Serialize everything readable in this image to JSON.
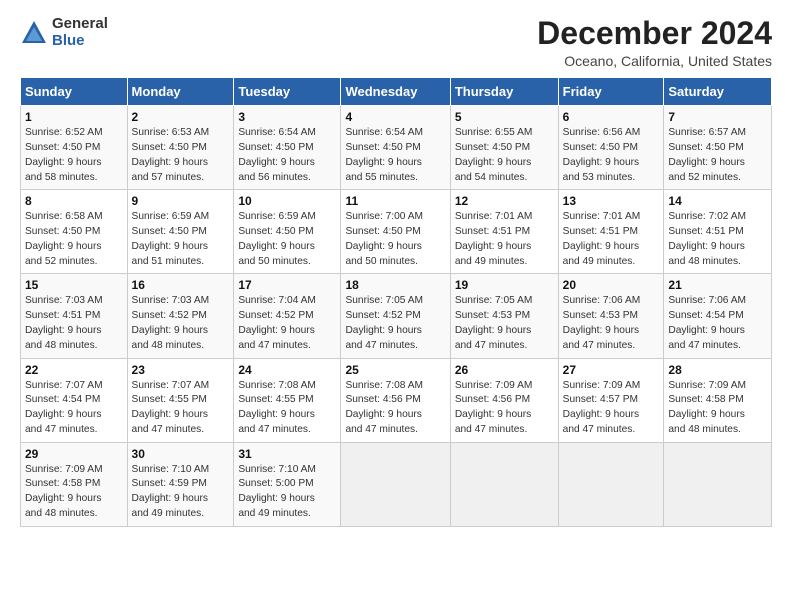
{
  "logo": {
    "text1": "General",
    "text2": "Blue"
  },
  "title": "December 2024",
  "subtitle": "Oceano, California, United States",
  "days_of_week": [
    "Sunday",
    "Monday",
    "Tuesday",
    "Wednesday",
    "Thursday",
    "Friday",
    "Saturday"
  ],
  "weeks": [
    [
      {
        "day": 1,
        "detail": "Sunrise: 6:52 AM\nSunset: 4:50 PM\nDaylight: 9 hours\nand 58 minutes."
      },
      {
        "day": 2,
        "detail": "Sunrise: 6:53 AM\nSunset: 4:50 PM\nDaylight: 9 hours\nand 57 minutes."
      },
      {
        "day": 3,
        "detail": "Sunrise: 6:54 AM\nSunset: 4:50 PM\nDaylight: 9 hours\nand 56 minutes."
      },
      {
        "day": 4,
        "detail": "Sunrise: 6:54 AM\nSunset: 4:50 PM\nDaylight: 9 hours\nand 55 minutes."
      },
      {
        "day": 5,
        "detail": "Sunrise: 6:55 AM\nSunset: 4:50 PM\nDaylight: 9 hours\nand 54 minutes."
      },
      {
        "day": 6,
        "detail": "Sunrise: 6:56 AM\nSunset: 4:50 PM\nDaylight: 9 hours\nand 53 minutes."
      },
      {
        "day": 7,
        "detail": "Sunrise: 6:57 AM\nSunset: 4:50 PM\nDaylight: 9 hours\nand 52 minutes."
      }
    ],
    [
      {
        "day": 8,
        "detail": "Sunrise: 6:58 AM\nSunset: 4:50 PM\nDaylight: 9 hours\nand 52 minutes."
      },
      {
        "day": 9,
        "detail": "Sunrise: 6:59 AM\nSunset: 4:50 PM\nDaylight: 9 hours\nand 51 minutes."
      },
      {
        "day": 10,
        "detail": "Sunrise: 6:59 AM\nSunset: 4:50 PM\nDaylight: 9 hours\nand 50 minutes."
      },
      {
        "day": 11,
        "detail": "Sunrise: 7:00 AM\nSunset: 4:50 PM\nDaylight: 9 hours\nand 50 minutes."
      },
      {
        "day": 12,
        "detail": "Sunrise: 7:01 AM\nSunset: 4:51 PM\nDaylight: 9 hours\nand 49 minutes."
      },
      {
        "day": 13,
        "detail": "Sunrise: 7:01 AM\nSunset: 4:51 PM\nDaylight: 9 hours\nand 49 minutes."
      },
      {
        "day": 14,
        "detail": "Sunrise: 7:02 AM\nSunset: 4:51 PM\nDaylight: 9 hours\nand 48 minutes."
      }
    ],
    [
      {
        "day": 15,
        "detail": "Sunrise: 7:03 AM\nSunset: 4:51 PM\nDaylight: 9 hours\nand 48 minutes."
      },
      {
        "day": 16,
        "detail": "Sunrise: 7:03 AM\nSunset: 4:52 PM\nDaylight: 9 hours\nand 48 minutes."
      },
      {
        "day": 17,
        "detail": "Sunrise: 7:04 AM\nSunset: 4:52 PM\nDaylight: 9 hours\nand 47 minutes."
      },
      {
        "day": 18,
        "detail": "Sunrise: 7:05 AM\nSunset: 4:52 PM\nDaylight: 9 hours\nand 47 minutes."
      },
      {
        "day": 19,
        "detail": "Sunrise: 7:05 AM\nSunset: 4:53 PM\nDaylight: 9 hours\nand 47 minutes."
      },
      {
        "day": 20,
        "detail": "Sunrise: 7:06 AM\nSunset: 4:53 PM\nDaylight: 9 hours\nand 47 minutes."
      },
      {
        "day": 21,
        "detail": "Sunrise: 7:06 AM\nSunset: 4:54 PM\nDaylight: 9 hours\nand 47 minutes."
      }
    ],
    [
      {
        "day": 22,
        "detail": "Sunrise: 7:07 AM\nSunset: 4:54 PM\nDaylight: 9 hours\nand 47 minutes."
      },
      {
        "day": 23,
        "detail": "Sunrise: 7:07 AM\nSunset: 4:55 PM\nDaylight: 9 hours\nand 47 minutes."
      },
      {
        "day": 24,
        "detail": "Sunrise: 7:08 AM\nSunset: 4:55 PM\nDaylight: 9 hours\nand 47 minutes."
      },
      {
        "day": 25,
        "detail": "Sunrise: 7:08 AM\nSunset: 4:56 PM\nDaylight: 9 hours\nand 47 minutes."
      },
      {
        "day": 26,
        "detail": "Sunrise: 7:09 AM\nSunset: 4:56 PM\nDaylight: 9 hours\nand 47 minutes."
      },
      {
        "day": 27,
        "detail": "Sunrise: 7:09 AM\nSunset: 4:57 PM\nDaylight: 9 hours\nand 47 minutes."
      },
      {
        "day": 28,
        "detail": "Sunrise: 7:09 AM\nSunset: 4:58 PM\nDaylight: 9 hours\nand 48 minutes."
      }
    ],
    [
      {
        "day": 29,
        "detail": "Sunrise: 7:09 AM\nSunset: 4:58 PM\nDaylight: 9 hours\nand 48 minutes."
      },
      {
        "day": 30,
        "detail": "Sunrise: 7:10 AM\nSunset: 4:59 PM\nDaylight: 9 hours\nand 49 minutes."
      },
      {
        "day": 31,
        "detail": "Sunrise: 7:10 AM\nSunset: 5:00 PM\nDaylight: 9 hours\nand 49 minutes."
      },
      null,
      null,
      null,
      null
    ]
  ]
}
